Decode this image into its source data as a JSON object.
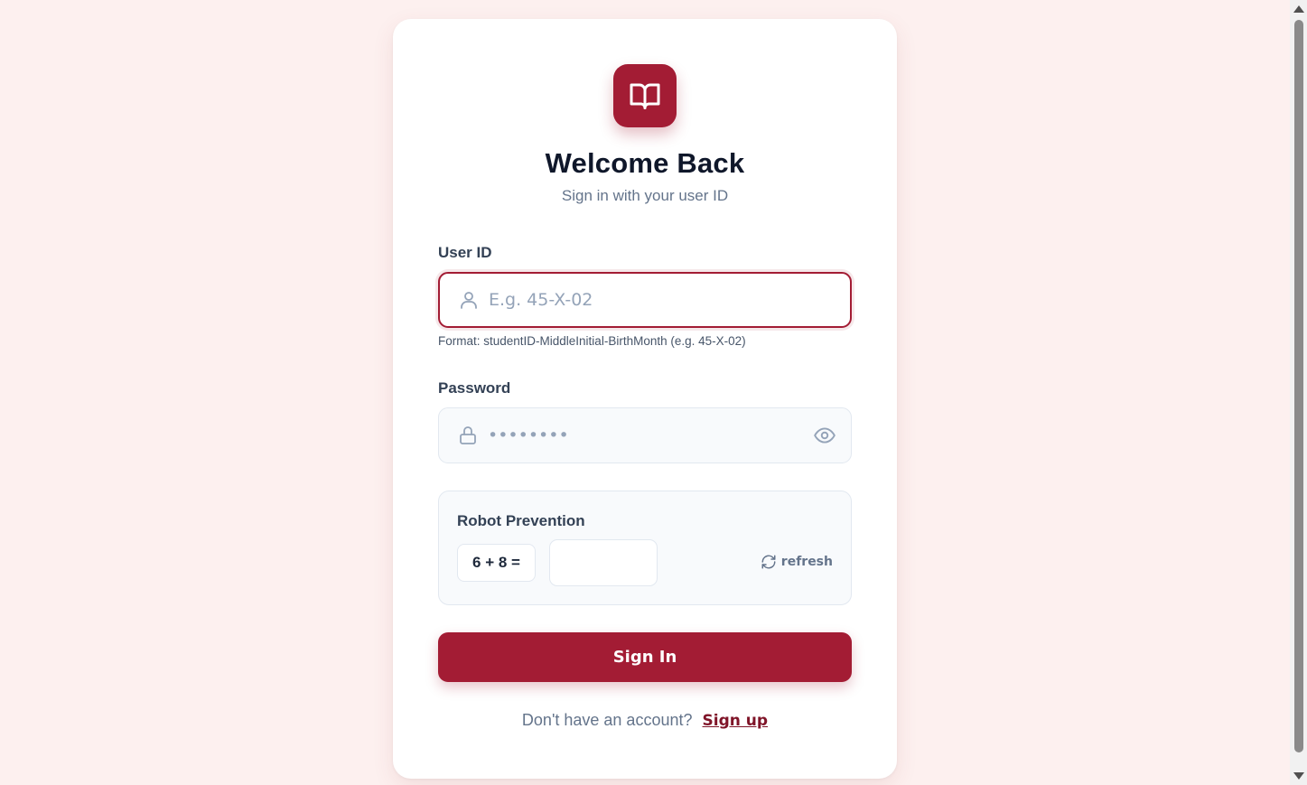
{
  "header": {
    "logo_icon": "open-book-icon",
    "title": "Welcome Back",
    "subtitle": "Sign in with your user ID"
  },
  "user_id": {
    "label": "User ID",
    "placeholder": "E.g. 45-X-02",
    "value": "",
    "icon": "user-icon",
    "hint": "Format: studentID-MiddleInitial-BirthMonth (e.g. 45-X-02)"
  },
  "password": {
    "label": "Password",
    "placeholder": "••••••••",
    "value": "",
    "icon": "lock-icon",
    "toggle_icon": "eye-icon"
  },
  "captcha": {
    "title": "Robot Prevention",
    "equation": "6 + 8 =",
    "answer": "",
    "refresh_label": "refresh",
    "refresh_icon": "refresh-icon"
  },
  "actions": {
    "signin_label": "Sign In"
  },
  "footer": {
    "prompt": "Don't have an account?",
    "signup_label": "Sign up"
  },
  "colors": {
    "accent": "#a31c34",
    "background": "#fdf0ef",
    "link": "#7f1428"
  }
}
